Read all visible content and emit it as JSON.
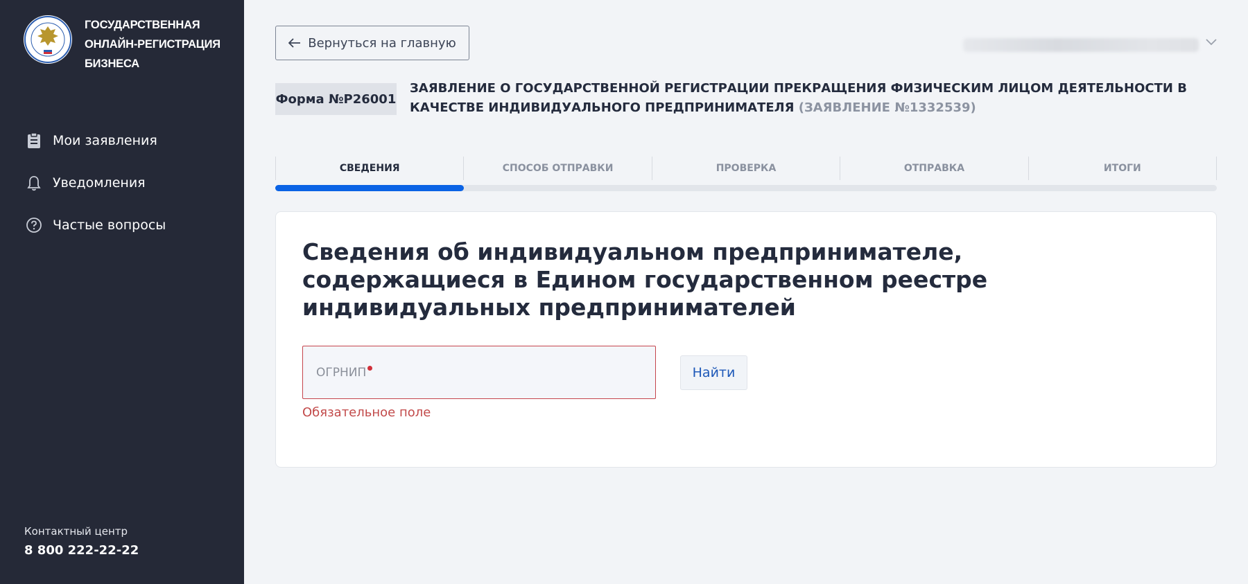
{
  "sidebar": {
    "logo": {
      "lines": [
        "ГОСУДАРСТВЕННАЯ",
        "ОНЛАЙН-РЕГИСТРАЦИЯ",
        "БИЗНЕСА"
      ],
      "emblem_icon": "fns-emblem-icon"
    },
    "nav": [
      {
        "label": "Мои заявления",
        "icon": "clipboard-icon"
      },
      {
        "label": "Уведомления",
        "icon": "bell-icon"
      },
      {
        "label": "Частые вопросы",
        "icon": "question-circle-icon"
      }
    ],
    "contact": {
      "label": "Контактный центр",
      "phone": "8 800 222-22-22"
    }
  },
  "header": {
    "back_label": "Вернуться на главную",
    "back_icon": "arrow-left-icon",
    "user_menu_icon": "chevron-down-icon"
  },
  "form": {
    "badge": "Форма №Р26001",
    "title": "ЗАЯВЛЕНИЕ О ГОСУДАРСТВЕННОЙ РЕГИСТРАЦИИ ПРЕКРАЩЕНИЯ ФИЗИЧЕСКИМ ЛИЦОМ ДЕЯТЕЛЬНОСТИ В КАЧЕСТВЕ ИНДИВИДУАЛЬНОГО ПРЕДПРИНИМАТЕЛЯ",
    "application_number": "(ЗАЯВЛЕНИЕ №1332539)"
  },
  "steps": {
    "items": [
      "СВЕДЕНИЯ",
      "СПОСОБ ОТПРАВКИ",
      "ПРОВЕРКА",
      "ОТПРАВКА",
      "ИТОГИ"
    ],
    "active_index": 0,
    "progress_fraction": 0.2
  },
  "card": {
    "title": "Сведения об индивидуальном предпринимателе, содержащиеся в Едином государственном реестре индивидуальных предпринимателей",
    "ogrnip": {
      "label": "ОГРНИП",
      "value": "",
      "error": "Обязательное поле"
    },
    "find_label": "Найти"
  },
  "colors": {
    "sidebar_bg": "#252937",
    "accent": "#0b63e5",
    "error": "#c5444c",
    "page_bg": "#f2f4f7"
  }
}
